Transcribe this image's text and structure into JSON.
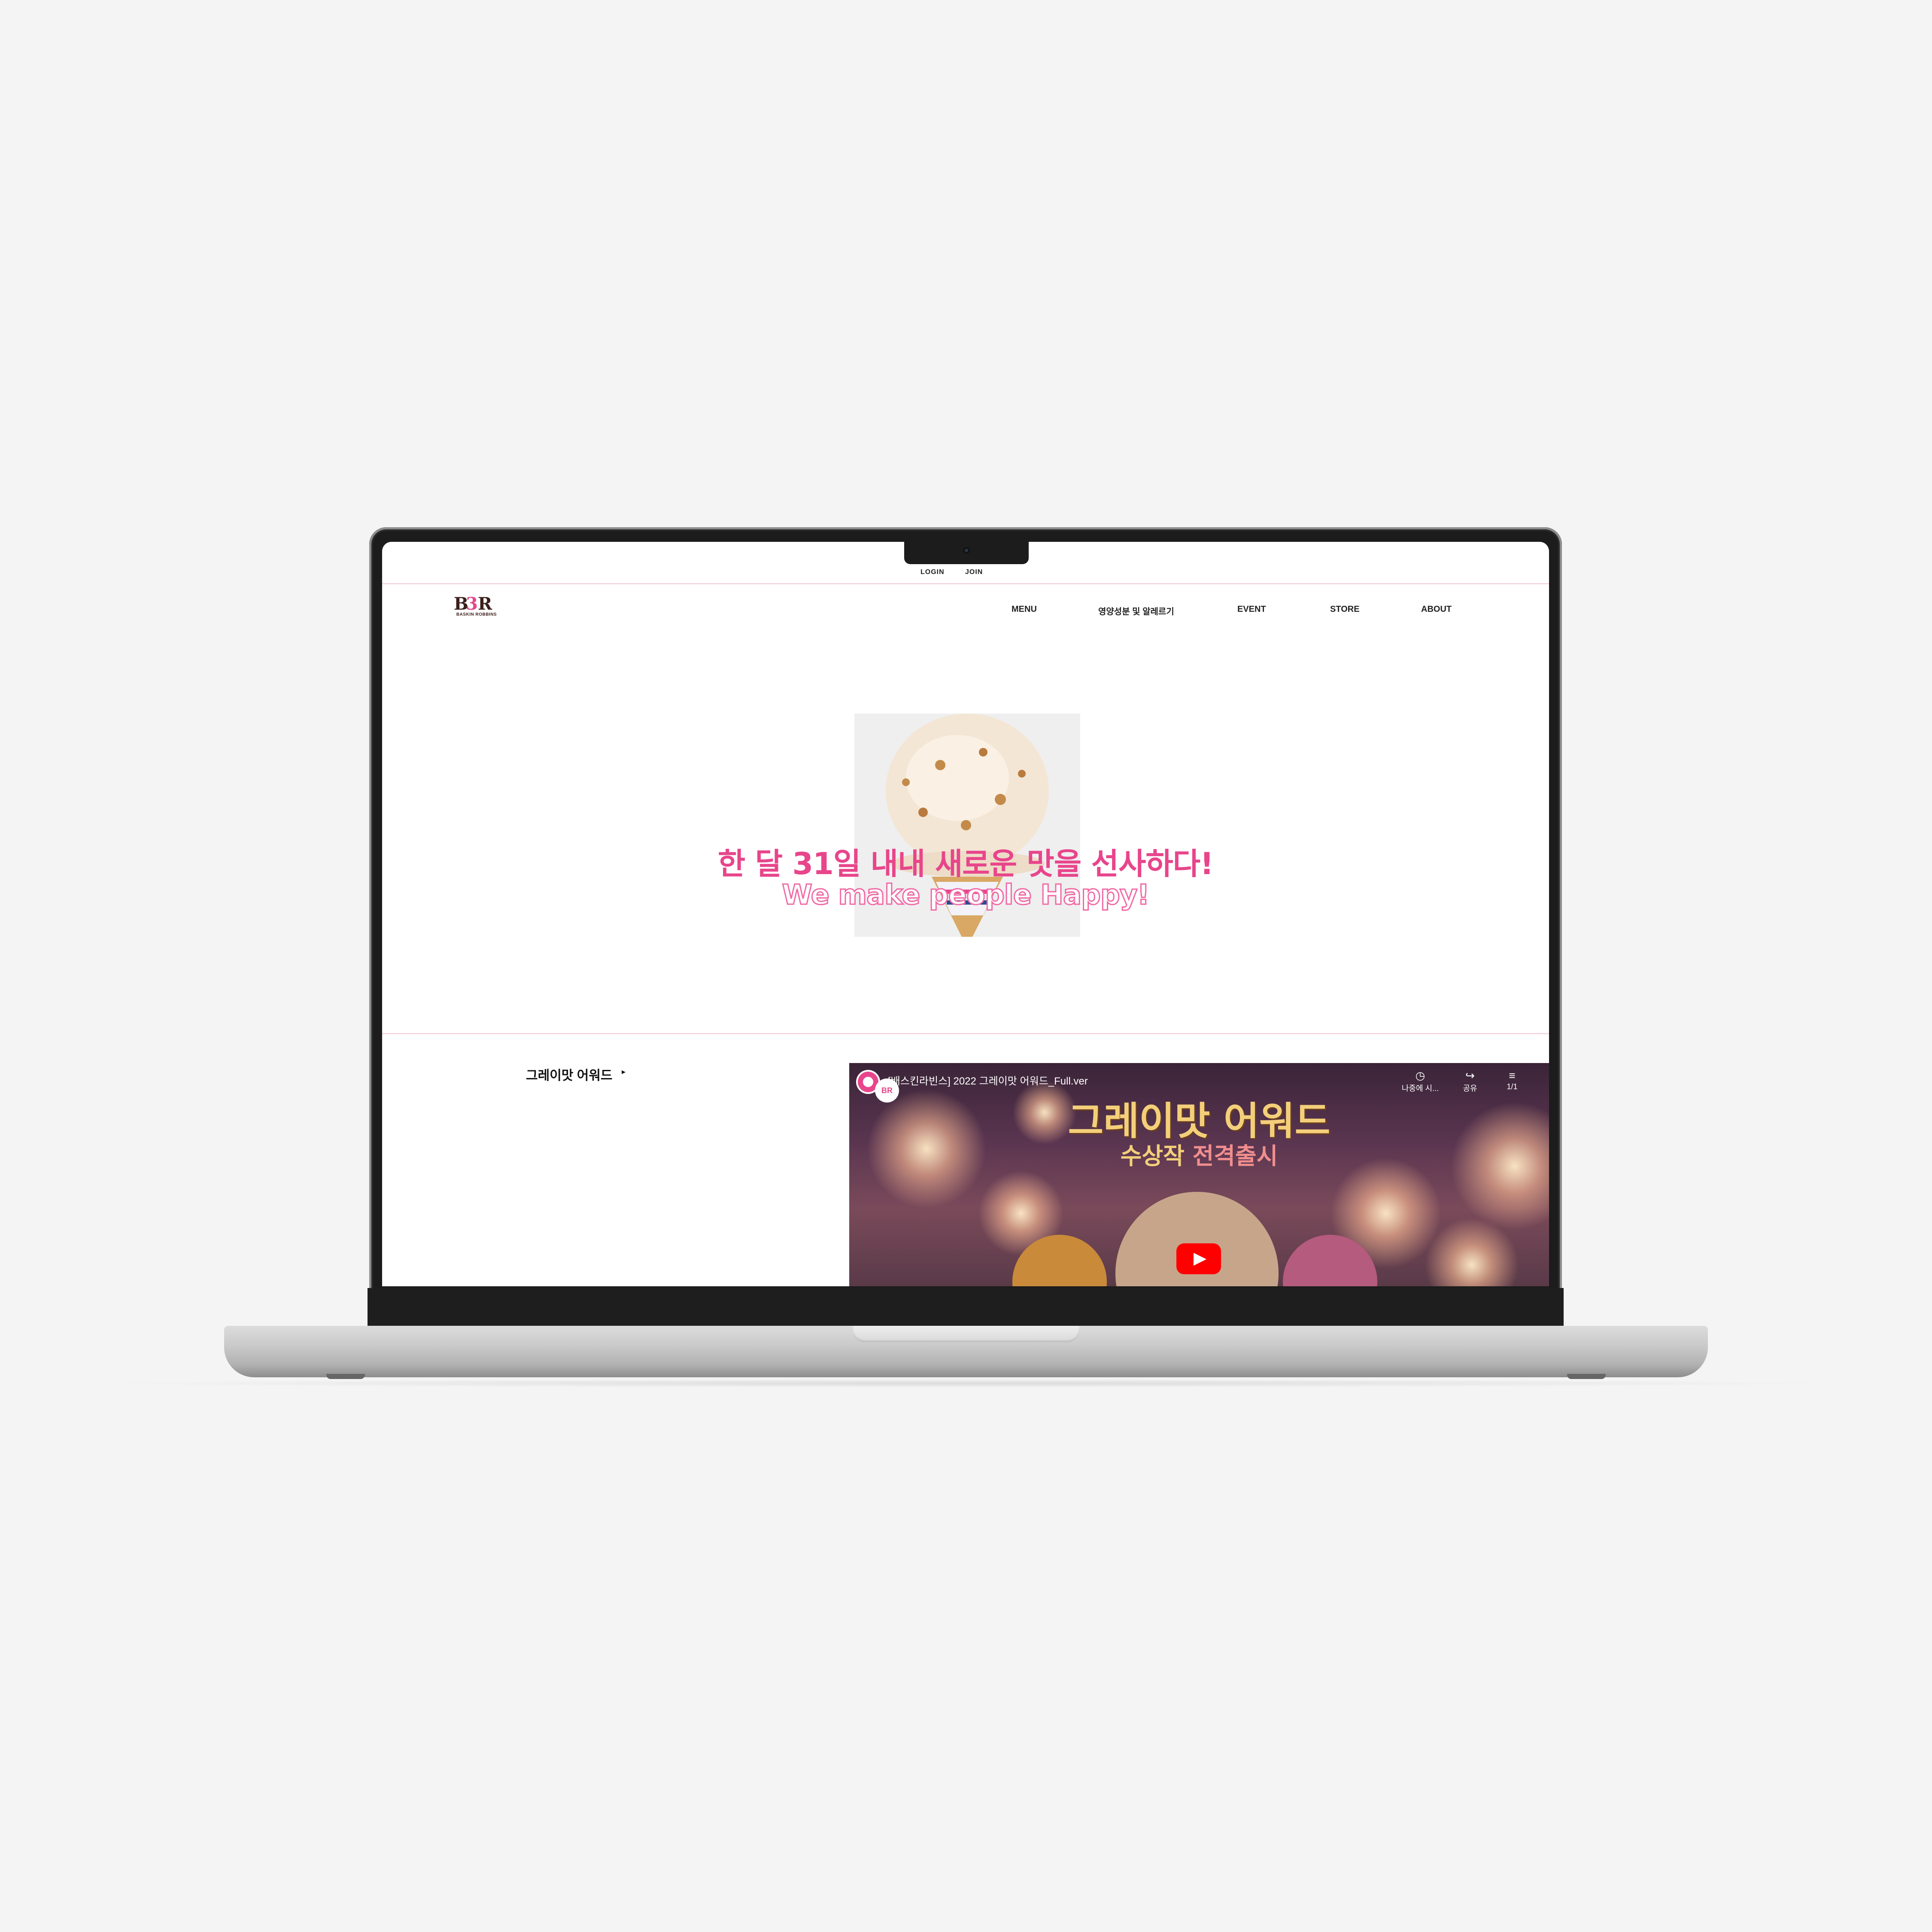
{
  "topbar": {
    "login": "LOGIN",
    "join": "JOIN"
  },
  "logo": {
    "mark": "BR",
    "wordmark": "BASKIN ROBBINS"
  },
  "nav": {
    "items": [
      {
        "label": "MENU"
      },
      {
        "label": "영양성분 및 알레르기"
      },
      {
        "label": "EVENT"
      },
      {
        "label": "STORE"
      },
      {
        "label": "ABOUT"
      }
    ]
  },
  "hero": {
    "title": "한 달 31일 내내 새로운 맛을 선사하다!",
    "subtitle": "We make people Happy!"
  },
  "section": {
    "title": "그레이맛 어워드",
    "arrow": "▸"
  },
  "video": {
    "title": "[배스킨라빈스] 2022 그레이맛 어워드_Full.ver",
    "controls": {
      "watch_later": "나중에 시...",
      "share": "공유",
      "playlist": "1/1"
    },
    "headline": "그레이맛 어워드",
    "subline_a": "수상작",
    "subline_b": "전격출시"
  },
  "colors": {
    "brand_pink": "#e8458b",
    "divider_pink": "#f6d7e3",
    "youtube_red": "#ff0000"
  },
  "icons": [
    "clock-icon",
    "share-icon",
    "playlist-icon",
    "play-icon",
    "caret-right-icon"
  ]
}
